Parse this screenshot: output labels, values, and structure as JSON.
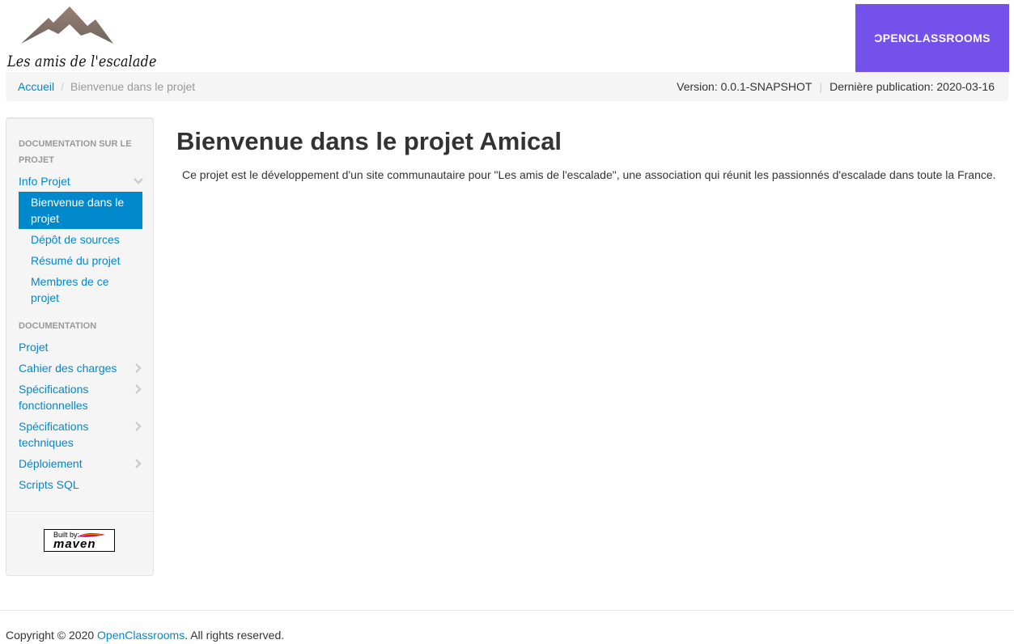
{
  "header": {
    "logo_text": "Les amis de l'escalade",
    "partner_logo_text": "ƆPENCLASSROOMS"
  },
  "breadcrumb": {
    "home": "Accueil",
    "separator": "/",
    "current": "Bienvenue dans le projet"
  },
  "publish_info": {
    "version": "Version: 0.0.1-SNAPSHOT",
    "separator": "|",
    "last_published": "Dernière publication: 2020-03-16"
  },
  "sidebar": {
    "section1_header": "DOCUMENTATION SUR LE PROJET",
    "info_projet": "Info Projet",
    "info_items": [
      "Bienvenue dans le projet",
      "Dépôt de sources",
      "Résumé du projet",
      "Membres de ce projet"
    ],
    "section2_header": "DOCUMENTATION",
    "doc_items": [
      "Projet",
      "Cahier des charges",
      "Spécifications fonctionnelles",
      "Spécifications techniques",
      "Déploiement",
      "Scripts SQL"
    ],
    "maven_badge": {
      "built_by": "Built by:",
      "word": "maven"
    }
  },
  "main": {
    "title": "Bienvenue dans le projet Amical",
    "paragraph": "Ce projet est le développement d'un site communautaire pour \"Les amis de l'escalade\", une association qui réunit les passionnés d'escalade dans toute la France."
  },
  "footer": {
    "copyright_prefix": "Copyright © 2020 ",
    "company_link": "OpenClassrooms",
    "copyright_suffix": ". All rights reserved."
  },
  "colors": {
    "link": "#0088cc",
    "active_bg": "#0088cc",
    "brand_purple": "#7451eb",
    "sidebar_bg": "#f5f5f5",
    "mountain": "#8a6f65"
  }
}
